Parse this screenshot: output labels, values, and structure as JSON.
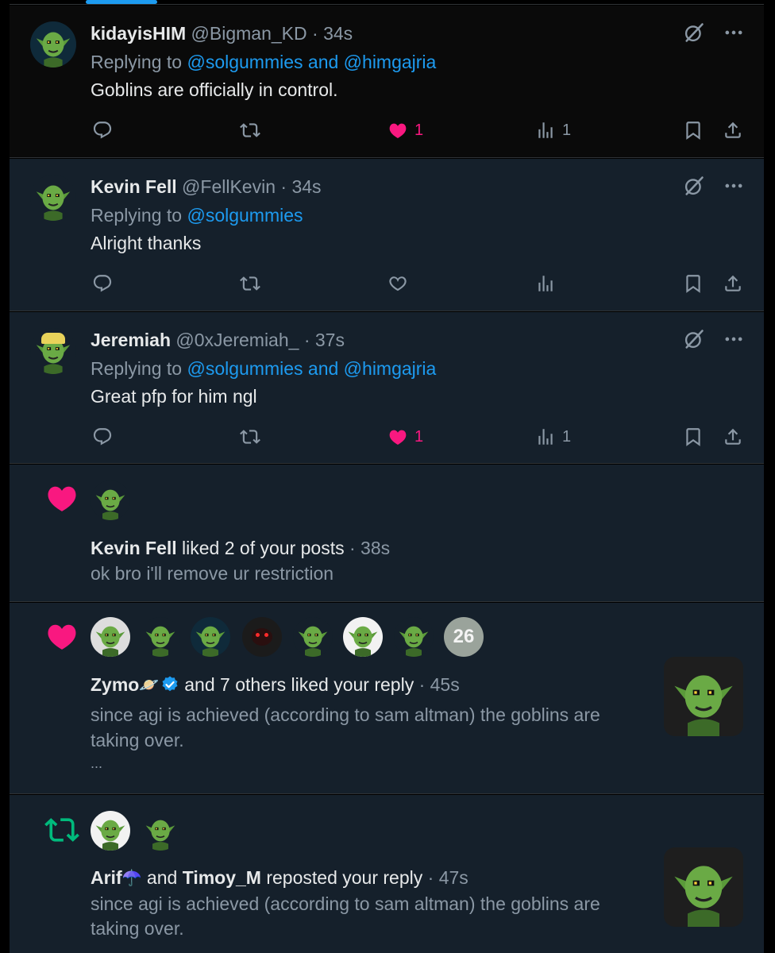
{
  "posts": [
    {
      "display_name": "kidayisHIM",
      "handle": "@Bigman_KD",
      "time": "· 34s",
      "replying_prefix": "Replying to",
      "replying_to": "@solgummies and @himgajria",
      "text": "Goblins are officially in control.",
      "like_count": "1",
      "view_count": "1",
      "liked": true
    },
    {
      "display_name": "Kevin Fell",
      "handle": "@FellKevin",
      "time": "· 34s",
      "replying_prefix": "Replying to",
      "replying_to": "@solgummies",
      "text": "Alright thanks",
      "like_count": "",
      "view_count": "",
      "liked": false
    },
    {
      "display_name": "Jeremiah",
      "handle": "@0xJeremiah_",
      "time": "· 37s",
      "replying_prefix": "Replying to",
      "replying_to": "@solgummies and @himgajria",
      "text": "Great pfp for him ngl",
      "like_count": "1",
      "view_count": "1",
      "liked": true
    }
  ],
  "notifications": [
    {
      "type": "like",
      "actor": "Kevin Fell",
      "action": "liked 2 of your posts",
      "time": "· 38s",
      "preview": "ok bro i'll remove ur restriction"
    },
    {
      "type": "like",
      "actor": "Zymo",
      "actor_emoji": "🪐",
      "action": "and 7 others liked your reply",
      "time": "· 45s",
      "preview_line1": "since agi is achieved (according to sam altman) the goblins are",
      "preview_line2": "taking over.",
      "more": "...",
      "extra_count_badge": "26"
    },
    {
      "type": "repost",
      "actor": "Arif",
      "actor_emoji": "☂️",
      "joiner": "and",
      "actor2": "Timoy_M",
      "action": "reposted your reply",
      "time": "· 47s",
      "preview_line1": "since agi is achieved (according to sam altman) the goblins are",
      "preview_line2": "taking over."
    }
  ],
  "icons": {
    "reply": "reply-icon",
    "repost": "repost-icon",
    "like": "heart-icon",
    "views": "views-icon",
    "bookmark": "bookmark-icon",
    "share": "share-icon",
    "grok": "grok-icon",
    "more": "more-icon"
  },
  "colors": {
    "like": "#f91880",
    "link": "#1d9bf0",
    "repost": "#00ba7c",
    "muted": "#8b98a5"
  }
}
